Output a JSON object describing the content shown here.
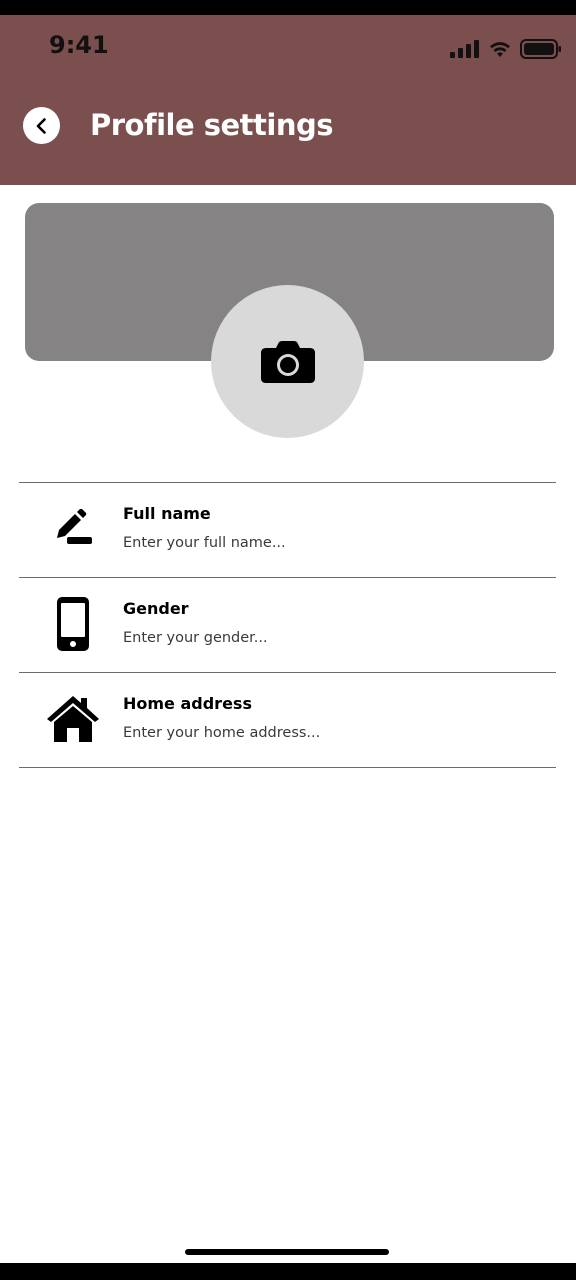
{
  "status_bar": {
    "time": "9:41",
    "icons": [
      "signal-icon",
      "wifi-icon",
      "battery-icon"
    ]
  },
  "header": {
    "back_icon": "chevron-left-icon",
    "title": "Profile settings"
  },
  "profile": {
    "cover_color": "#858383",
    "avatar_icon": "camera-icon"
  },
  "fields": [
    {
      "icon": "pencil-icon",
      "label": "Full name",
      "placeholder": "Enter your full name..."
    },
    {
      "icon": "phone-icon",
      "label": "Gender",
      "placeholder": "Enter your gender..."
    },
    {
      "icon": "home-icon",
      "label": "Home address",
      "placeholder": "Enter your home address..."
    }
  ],
  "colors": {
    "header_bg": "#7a4f4e",
    "avatar_bg": "#d9d9d9",
    "text_primary": "#000000"
  }
}
